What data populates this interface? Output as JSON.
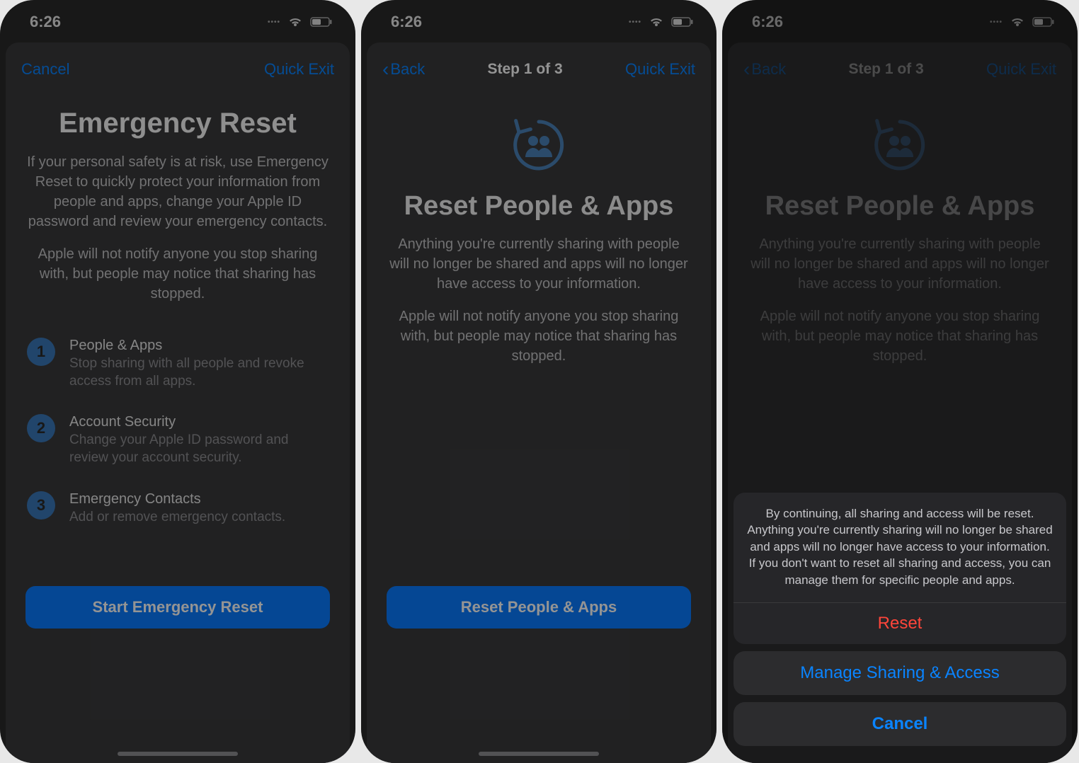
{
  "status": {
    "time": "6:26"
  },
  "screen1": {
    "nav": {
      "left": "Cancel",
      "right": "Quick Exit"
    },
    "title": "Emergency Reset",
    "body1": "If your personal safety is at risk, use Emergency Reset to quickly protect your information from people and apps, change your Apple ID password and review your emergency contacts.",
    "body2": "Apple will not notify anyone you stop sharing with, but people may notice that sharing has stopped.",
    "steps": [
      {
        "num": "1",
        "title": "People & Apps",
        "desc": "Stop sharing with all people and revoke access from all apps."
      },
      {
        "num": "2",
        "title": "Account Security",
        "desc": "Change your Apple ID password and review your account security."
      },
      {
        "num": "3",
        "title": "Emergency Contacts",
        "desc": "Add or remove emergency contacts."
      }
    ],
    "cta": "Start Emergency Reset"
  },
  "screen2": {
    "nav": {
      "back": "Back",
      "title": "Step 1 of 3",
      "right": "Quick Exit"
    },
    "title": "Reset People & Apps",
    "body1": "Anything you're currently sharing with people will no longer be shared and apps will no longer have access to your information.",
    "body2": "Apple will not notify anyone you stop sharing with, but people may notice that sharing has stopped.",
    "cta": "Reset People & Apps"
  },
  "screen3": {
    "nav": {
      "back": "Back",
      "title": "Step 1 of 3",
      "right": "Quick Exit"
    },
    "title": "Reset People & Apps",
    "body1": "Anything you're currently sharing with people will no longer be shared and apps will no longer have access to your information.",
    "body2": "Apple will not notify anyone you stop sharing with, but people may notice that sharing has stopped.",
    "sheet": {
      "message": "By continuing, all sharing and access will be reset. Anything you're currently sharing will no longer be shared and apps will no longer have access to your information. If you don't want to reset all sharing and access, you can manage them for specific people and apps.",
      "reset": "Reset",
      "manage": "Manage Sharing & Access",
      "cancel": "Cancel"
    }
  }
}
